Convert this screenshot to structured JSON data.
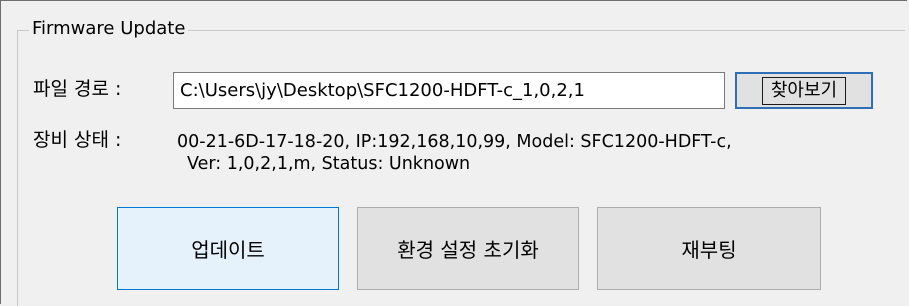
{
  "group": {
    "title": "Firmware Update"
  },
  "file_path": {
    "label": "파일 경로 :",
    "value": "C:\\Users\\jy\\Desktop\\SFC1200-HDFT-c_1,0,2,1",
    "browse_label": "찾아보기"
  },
  "device_status": {
    "label": "장비 상태 :",
    "line1": "00-21-6D-17-18-20, IP:192,168,10,99, Model: SFC1200-HDFT-c,",
    "line2": "Ver: 1,0,2,1,m, Status: Unknown"
  },
  "actions": {
    "update_label": "업데이트",
    "reset_label": "환경 설정 초기화",
    "reboot_label": "재부팅"
  },
  "colors": {
    "window_bg": "#f0f0f0",
    "focus_border": "#0078d7",
    "focus_bg": "#e5f1fb",
    "button_bg": "#e1e1e1"
  }
}
